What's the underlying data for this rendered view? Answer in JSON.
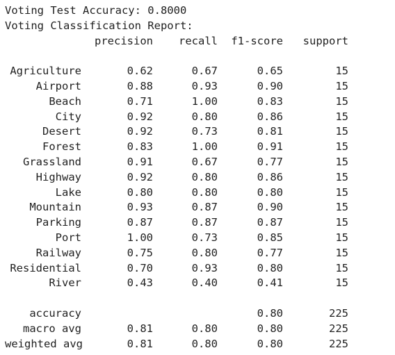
{
  "accuracy_line": "Voting Test Accuracy: 0.8000",
  "report_title": "Voting Classification Report:",
  "headers": {
    "precision": "precision",
    "recall": "recall",
    "f1": "f1-score",
    "support": "support"
  },
  "rows": [
    {
      "label": "Agriculture",
      "precision": "0.62",
      "recall": "0.67",
      "f1": "0.65",
      "support": "15"
    },
    {
      "label": "Airport",
      "precision": "0.88",
      "recall": "0.93",
      "f1": "0.90",
      "support": "15"
    },
    {
      "label": "Beach",
      "precision": "0.71",
      "recall": "1.00",
      "f1": "0.83",
      "support": "15"
    },
    {
      "label": "City",
      "precision": "0.92",
      "recall": "0.80",
      "f1": "0.86",
      "support": "15"
    },
    {
      "label": "Desert",
      "precision": "0.92",
      "recall": "0.73",
      "f1": "0.81",
      "support": "15"
    },
    {
      "label": "Forest",
      "precision": "0.83",
      "recall": "1.00",
      "f1": "0.91",
      "support": "15"
    },
    {
      "label": "Grassland",
      "precision": "0.91",
      "recall": "0.67",
      "f1": "0.77",
      "support": "15"
    },
    {
      "label": "Highway",
      "precision": "0.92",
      "recall": "0.80",
      "f1": "0.86",
      "support": "15"
    },
    {
      "label": "Lake",
      "precision": "0.80",
      "recall": "0.80",
      "f1": "0.80",
      "support": "15"
    },
    {
      "label": "Mountain",
      "precision": "0.93",
      "recall": "0.87",
      "f1": "0.90",
      "support": "15"
    },
    {
      "label": "Parking",
      "precision": "0.87",
      "recall": "0.87",
      "f1": "0.87",
      "support": "15"
    },
    {
      "label": "Port",
      "precision": "1.00",
      "recall": "0.73",
      "f1": "0.85",
      "support": "15"
    },
    {
      "label": "Railway",
      "precision": "0.75",
      "recall": "0.80",
      "f1": "0.77",
      "support": "15"
    },
    {
      "label": "Residential",
      "precision": "0.70",
      "recall": "0.93",
      "f1": "0.80",
      "support": "15"
    },
    {
      "label": "River",
      "precision": "0.43",
      "recall": "0.40",
      "f1": "0.41",
      "support": "15"
    }
  ],
  "summary": [
    {
      "label": "accuracy",
      "precision": "",
      "recall": "",
      "f1": "0.80",
      "support": "225"
    },
    {
      "label": "macro avg",
      "precision": "0.81",
      "recall": "0.80",
      "f1": "0.80",
      "support": "225"
    },
    {
      "label": "weighted avg",
      "precision": "0.81",
      "recall": "0.80",
      "f1": "0.80",
      "support": "225"
    }
  ]
}
